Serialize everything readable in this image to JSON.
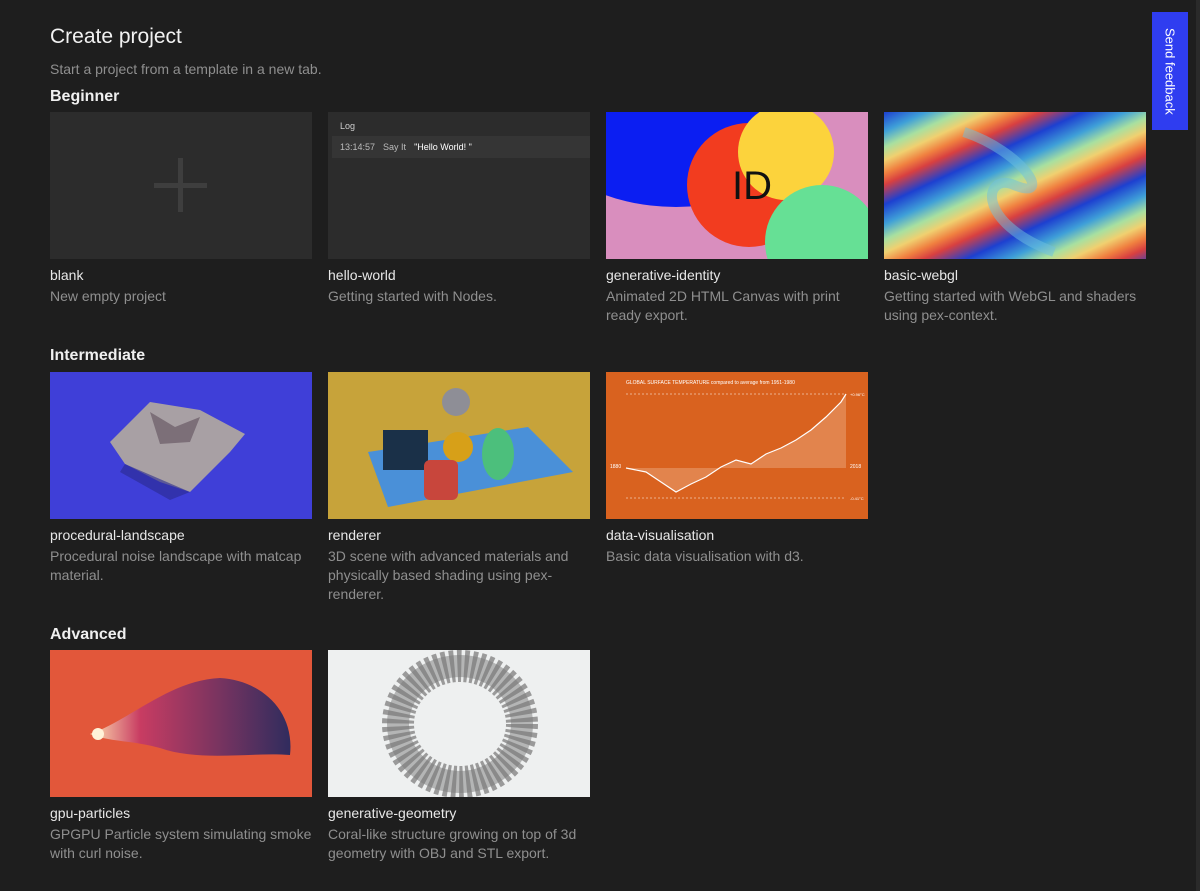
{
  "header": {
    "title": "Create project",
    "subtitle": "Start a project from a template in a new tab."
  },
  "feedback_label": "Send feedback",
  "sections": [
    {
      "title": "Beginner",
      "cards": [
        {
          "name": "blank",
          "description": "New empty project"
        },
        {
          "name": "hello-world",
          "description": "Getting started with Nodes."
        },
        {
          "name": "generative-identity",
          "description": "Animated 2D HTML Canvas with print ready export."
        },
        {
          "name": "basic-webgl",
          "description": "Getting started with WebGL and shaders using pex-context."
        }
      ]
    },
    {
      "title": "Intermediate",
      "cards": [
        {
          "name": "procedural-landscape",
          "description": "Procedural noise landscape with matcap material."
        },
        {
          "name": "renderer",
          "description": "3D scene with advanced materials and physically based shading using pex-renderer."
        },
        {
          "name": "data-visualisation",
          "description": "Basic data visualisation with d3."
        }
      ]
    },
    {
      "title": "Advanced",
      "cards": [
        {
          "name": "gpu-particles",
          "description": "GPGPU Particle system simulating smoke with curl noise."
        },
        {
          "name": "generative-geometry",
          "description": "Coral-like structure growing on top of 3d geometry with OBJ and STL export."
        }
      ]
    }
  ],
  "thumbs": {
    "hello_world": {
      "log_title": "Log",
      "time": "13:14:57",
      "action": "Say It",
      "message": "\"Hello World! \""
    },
    "identity_text": "ID",
    "dataviz": {
      "title": "GLOBAL SURFACE TEMPERATURE compared to average from 1951-1980",
      "start_year": "1880",
      "end_year": "2018",
      "high": "+0.96°C",
      "low": "-0.41°C"
    }
  },
  "colors": {
    "background": "#1e1e1e",
    "accent": "#2f3df0"
  }
}
